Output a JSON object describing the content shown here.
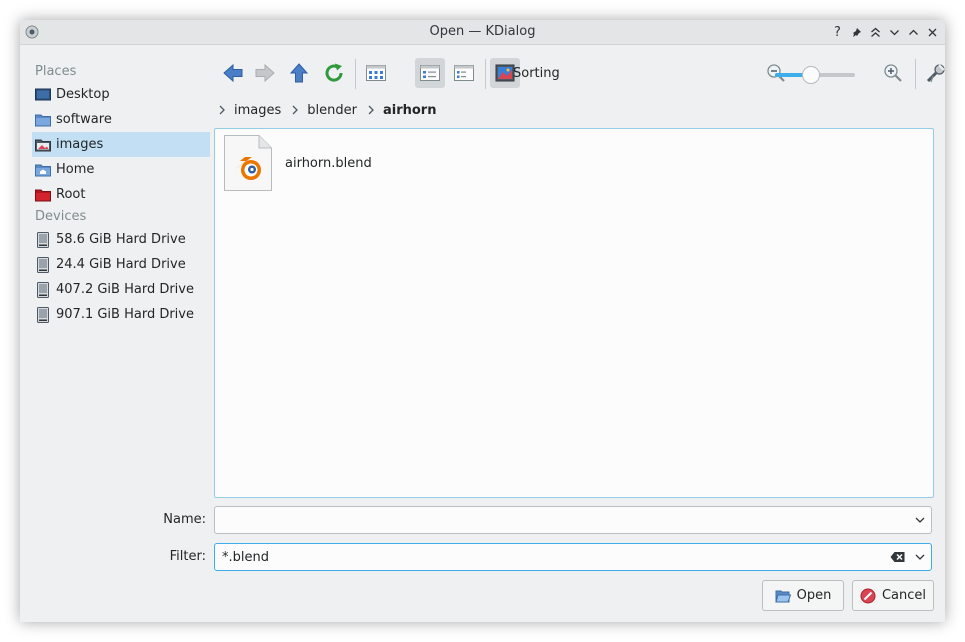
{
  "window": {
    "title": "Open — KDialog",
    "buttons": [
      "help",
      "pin",
      "keep-above",
      "minimize",
      "maximize",
      "close"
    ],
    "help_glyph": "?"
  },
  "places": {
    "section_places": "Places",
    "section_devices": "Devices",
    "items": [
      {
        "label": "Desktop",
        "icon": "desktop-icon",
        "selected": false
      },
      {
        "label": "software",
        "icon": "folder-icon",
        "selected": false
      },
      {
        "label": "images",
        "icon": "folder-images-icon",
        "selected": true
      },
      {
        "label": "Home",
        "icon": "home-folder-icon",
        "selected": false
      },
      {
        "label": "Root",
        "icon": "root-folder-icon",
        "selected": false
      }
    ],
    "devices": [
      {
        "label": "58.6 GiB Hard Drive",
        "icon": "hard-drive-icon"
      },
      {
        "label": "24.4 GiB Hard Drive",
        "icon": "hard-drive-icon"
      },
      {
        "label": "407.2 GiB Hard Drive",
        "icon": "hard-drive-icon"
      },
      {
        "label": "907.1 GiB Hard Drive",
        "icon": "hard-drive-icon"
      }
    ]
  },
  "toolbar": {
    "sorting_label": "Sorting",
    "icons": [
      "back-arrow-icon",
      "forward-arrow-icon",
      "up-arrow-icon",
      "reload-icon",
      "icons-view-icon",
      "compact-view-icon",
      "details-view-icon",
      "preview-icon",
      "zoom-out-icon",
      "zoom-in-icon",
      "options-wrench-icon"
    ],
    "zoom_level": 0.45
  },
  "breadcrumb": {
    "items": [
      "images",
      "blender",
      "airhorn"
    ]
  },
  "files": [
    {
      "name": "airhorn.blend",
      "icon": "blender-file-icon"
    }
  ],
  "name_field": {
    "label": "Name:",
    "value": ""
  },
  "filter_field": {
    "label": "Filter:",
    "value": "*.blend"
  },
  "buttons": {
    "open": "Open",
    "cancel": "Cancel"
  },
  "colors": {
    "accent": "#3daee9",
    "selection": "#c2dff3",
    "window_bg": "#eff0f1"
  }
}
